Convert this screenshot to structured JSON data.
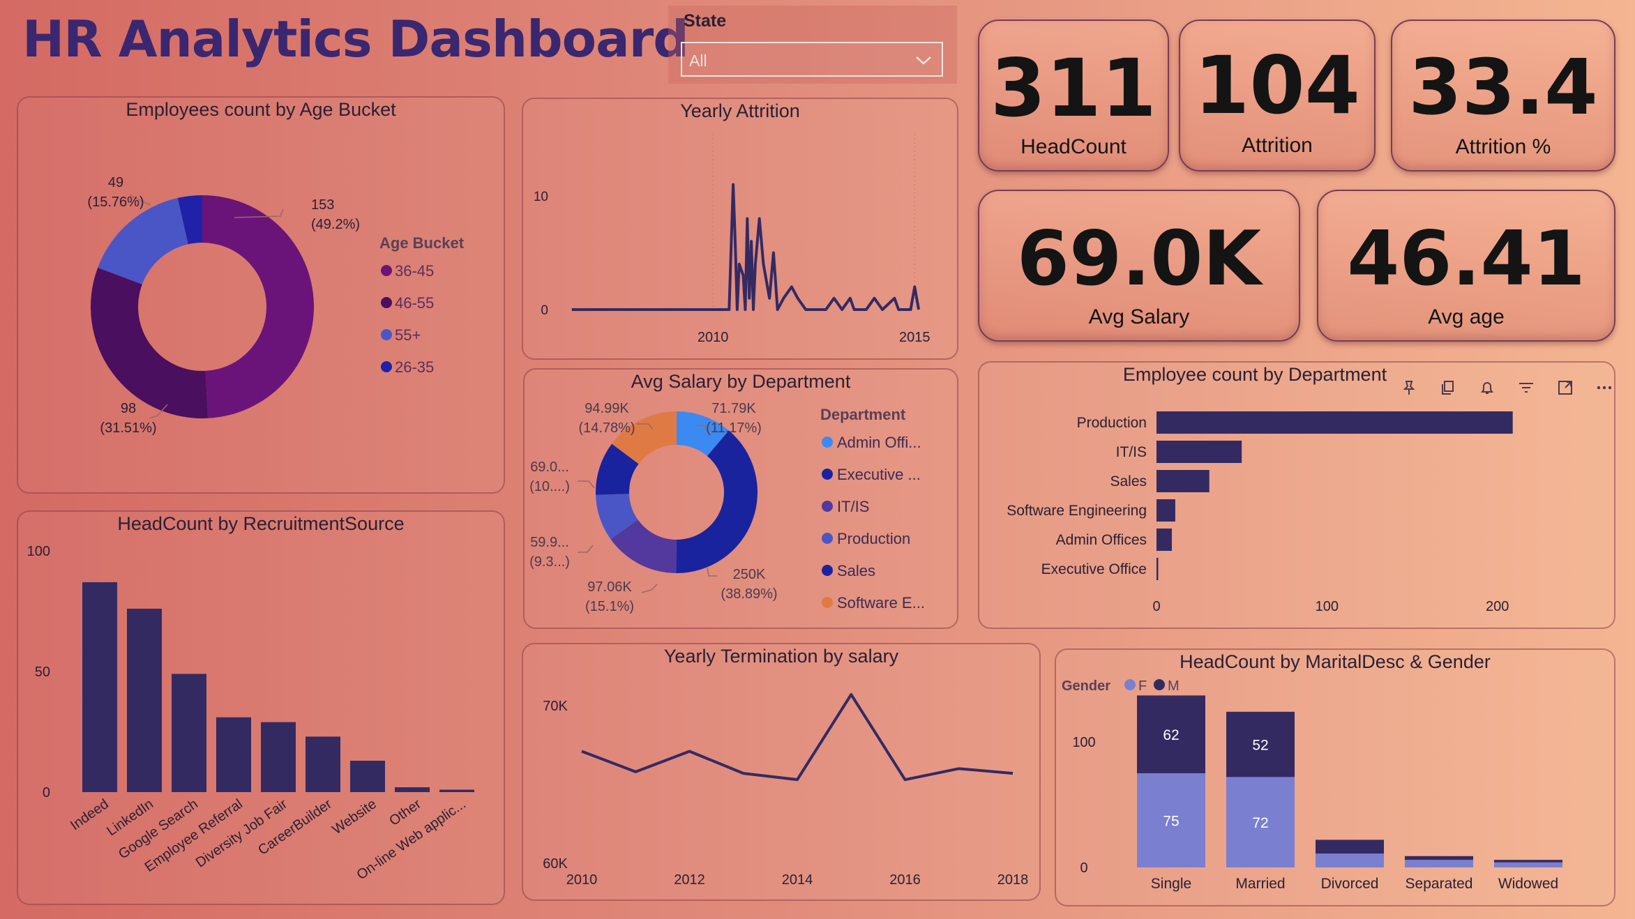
{
  "header": {
    "title": "HR Analytics Dashboard"
  },
  "slicer": {
    "label": "State",
    "value": "All"
  },
  "kpis": [
    {
      "value": "311",
      "label": "HeadCount"
    },
    {
      "value": "104",
      "label": "Attrition"
    },
    {
      "value": "33.4",
      "label": "Attrition %"
    },
    {
      "value": "69.0K",
      "label": "Avg Salary"
    },
    {
      "value": "46.41",
      "label": "Avg age"
    }
  ],
  "colors": {
    "navy": "#342a62",
    "purple": "#6a147a",
    "darkpurple": "#4a0f5e",
    "blue": "#4a56c6",
    "royal": "#1f22a8"
  },
  "chart_data": [
    {
      "id": "age",
      "type": "pie",
      "title": "Employees count by Age Bucket",
      "legend_title": "Age Bucket",
      "legend_position": "right",
      "slices": [
        {
          "name": "36-45",
          "value": 153,
          "pct": "49.2%",
          "color": "#6a147a"
        },
        {
          "name": "46-55",
          "value": 98,
          "pct": "31.51%",
          "color": "#4a0f5e"
        },
        {
          "name": "55+",
          "value": 49,
          "pct": "15.76%",
          "color": "#4a56c6"
        },
        {
          "name": "26-35",
          "value": 11,
          "pct": "",
          "color": "#1f22a8"
        }
      ]
    },
    {
      "id": "attrition",
      "type": "line",
      "title": "Yearly Attrition",
      "xlim": [
        2006.4,
        2015.6
      ],
      "ylim": [
        0,
        13
      ],
      "yticks": [
        0,
        10
      ],
      "xticks": [
        2010,
        2015
      ],
      "points": [
        [
          2006.5,
          0
        ],
        [
          2010,
          0
        ],
        [
          2010.4,
          0
        ],
        [
          2010.5,
          11
        ],
        [
          2010.55,
          6
        ],
        [
          2010.6,
          0
        ],
        [
          2010.65,
          4
        ],
        [
          2010.75,
          3
        ],
        [
          2010.8,
          0
        ],
        [
          2010.85,
          8
        ],
        [
          2010.9,
          1
        ],
        [
          2010.95,
          6
        ],
        [
          2011.0,
          0
        ],
        [
          2011.05,
          4
        ],
        [
          2011.15,
          8
        ],
        [
          2011.25,
          4
        ],
        [
          2011.4,
          1
        ],
        [
          2011.5,
          5
        ],
        [
          2011.6,
          0
        ],
        [
          2011.75,
          1
        ],
        [
          2011.95,
          2
        ],
        [
          2012.1,
          1
        ],
        [
          2012.3,
          0
        ],
        [
          2012.8,
          0
        ],
        [
          2013.0,
          1
        ],
        [
          2013.2,
          0
        ],
        [
          2013.4,
          1
        ],
        [
          2013.5,
          0
        ],
        [
          2013.8,
          0
        ],
        [
          2014.0,
          1
        ],
        [
          2014.2,
          0
        ],
        [
          2014.5,
          1
        ],
        [
          2014.6,
          0
        ],
        [
          2014.9,
          0
        ],
        [
          2015.0,
          2
        ],
        [
          2015.1,
          0
        ]
      ]
    },
    {
      "id": "dept_salary",
      "type": "pie",
      "title": "Avg Salary by Department",
      "legend_title": "Department",
      "legend_position": "right",
      "slices": [
        {
          "name": "Admin Offi...",
          "label": "71.79K",
          "pct": "(11.17%)",
          "value": 71.79,
          "color": "#3b8af2"
        },
        {
          "name": "Executive ...",
          "label": "250K",
          "pct": "(38.89%)",
          "value": 250,
          "color": "#1a239e"
        },
        {
          "name": "IT/IS",
          "label": "97.06K",
          "pct": "(15.1%)",
          "value": 97.06,
          "color": "#53389e"
        },
        {
          "name": "Production",
          "label": "59.9...",
          "pct": "(9.3...)",
          "value": 59.9,
          "color": "#4a56c6"
        },
        {
          "name": "Sales",
          "label": "69.0...",
          "pct": "(10....)",
          "value": 69.0,
          "color": "#1a239e"
        },
        {
          "name": "Software E...",
          "label": "94.99K",
          "pct": "(14.78%)",
          "value": 94.99,
          "color": "#e07a45"
        }
      ]
    },
    {
      "id": "dept_count",
      "type": "bar",
      "orientation": "horizontal",
      "title": "Employee count by Department",
      "categories": [
        "Production",
        "IT/IS",
        "Sales",
        "Software Engineering",
        "Admin Offices",
        "Executive Office"
      ],
      "values": [
        209,
        50,
        31,
        11,
        9,
        1
      ],
      "xlim": [
        0,
        230
      ],
      "xticks": [
        0,
        100,
        200
      ]
    },
    {
      "id": "recruit",
      "type": "bar",
      "title": "HeadCount by RecruitmentSource",
      "categories": [
        "Indeed",
        "LinkedIn",
        "Google Search",
        "Employee Referral",
        "Diversity Job Fair",
        "CareerBuilder",
        "Website",
        "Other",
        "On-line Web applic..."
      ],
      "values": [
        87,
        76,
        49,
        31,
        29,
        23,
        13,
        2,
        1
      ],
      "ylim": [
        0,
        100
      ],
      "yticks": [
        0,
        50,
        100
      ]
    },
    {
      "id": "termination",
      "type": "line",
      "title": "Yearly Termination by salary",
      "x": [
        2010,
        2011,
        2012,
        2013,
        2014,
        2015,
        2016,
        2017,
        2018
      ],
      "values": [
        67100,
        65800,
        67100,
        65700,
        65300,
        70700,
        65300,
        66000,
        65700
      ],
      "xlim": [
        2010,
        2018
      ],
      "ylim": [
        60000,
        71500
      ],
      "yticks": [
        [
          60000,
          "60K"
        ],
        [
          70000,
          "70K"
        ]
      ],
      "xticks": [
        2010,
        2012,
        2014,
        2016,
        2018
      ]
    },
    {
      "id": "marital",
      "type": "bar",
      "stacked": true,
      "title": "HeadCount by MaritalDesc & Gender",
      "legend_title": "Gender",
      "legend_position": "top-left",
      "categories": [
        "Single",
        "Married",
        "Divorced",
        "Separated",
        "Widowed"
      ],
      "series": [
        {
          "name": "F",
          "values": [
            75,
            72,
            11,
            6,
            4
          ],
          "color": "#7b7fd0"
        },
        {
          "name": "M",
          "values": [
            62,
            52,
            11,
            3,
            2
          ],
          "color": "#342a62"
        }
      ],
      "ylim": [
        0,
        140
      ],
      "yticks": [
        0,
        100
      ]
    }
  ]
}
